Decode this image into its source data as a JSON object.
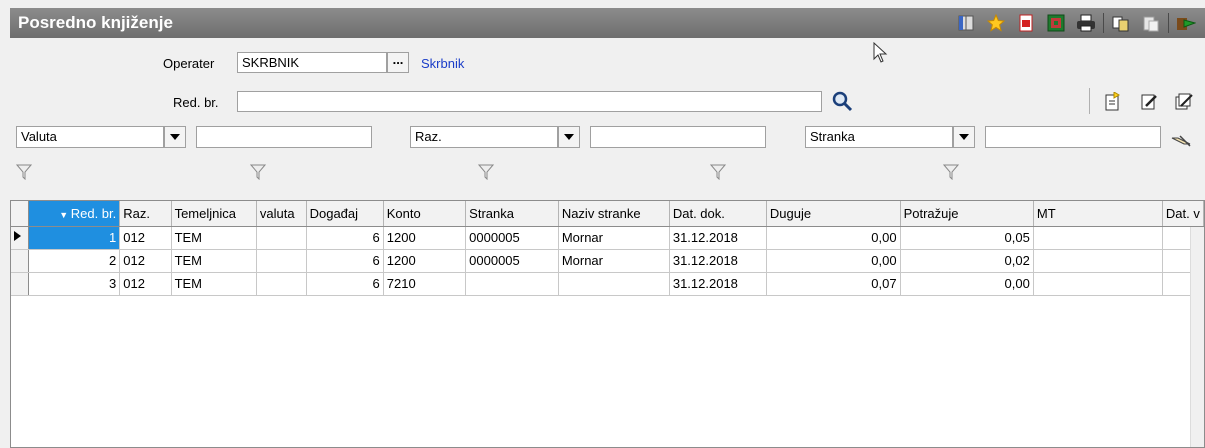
{
  "window": {
    "title": "Posredno knjiženje"
  },
  "toolbar": {
    "icons": [
      "columns-icon",
      "star-icon",
      "pdf-icon",
      "excel-icon",
      "print-icon",
      "copy-icon",
      "paste-icon",
      "exit-icon"
    ]
  },
  "form": {
    "operater_label": "Operater",
    "operater_value": "SKRBNIK",
    "operater_lookup": "...",
    "operater_name": "Skrbnik",
    "redbr_label": "Red. br.",
    "redbr_value": ""
  },
  "filters": {
    "combo1": "Valuta",
    "combo2": "Raz.",
    "combo3": "Stranka"
  },
  "grid": {
    "columns": [
      "Red. br.",
      "Raz.",
      "Temeljnica",
      "valuta",
      "Događaj",
      "Konto",
      "Stranka",
      "Naziv stranke",
      "Dat. dok.",
      "Duguje",
      "Potražuje",
      "MT",
      "Dat. v"
    ],
    "rows": [
      [
        "1",
        "012",
        "TEM",
        "",
        "6",
        "1200",
        "0000005",
        "Mornar",
        "31.12.2018",
        "0,00",
        "0,05",
        "",
        ""
      ],
      [
        "2",
        "012",
        "TEM",
        "",
        "6",
        "1200",
        "0000005",
        "Mornar",
        "31.12.2018",
        "0,00",
        "0,02",
        "",
        ""
      ],
      [
        "3",
        "012",
        "TEM",
        "",
        "6",
        "7210",
        "",
        "",
        "31.12.2018",
        "0,07",
        "0,00",
        "",
        ""
      ]
    ]
  }
}
